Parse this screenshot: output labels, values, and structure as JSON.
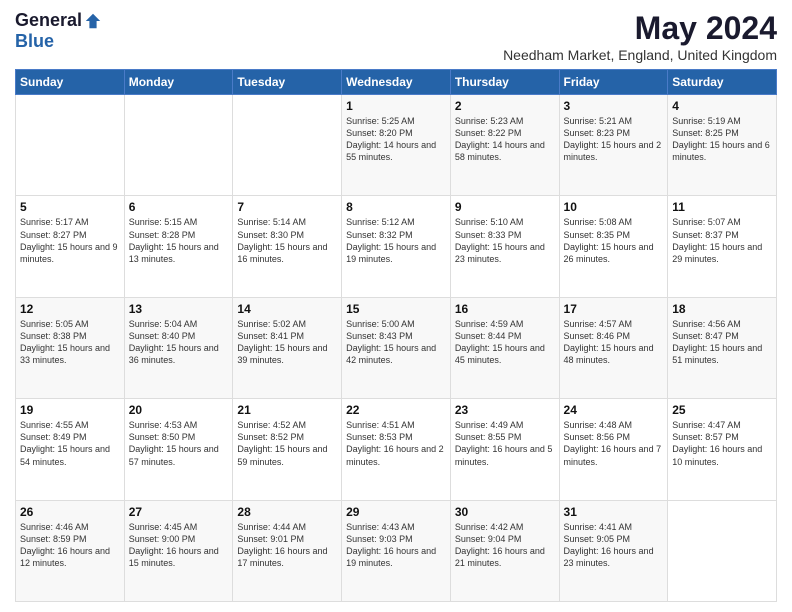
{
  "header": {
    "logo_general": "General",
    "logo_blue": "Blue",
    "month_title": "May 2024",
    "location": "Needham Market, England, United Kingdom"
  },
  "days_of_week": [
    "Sunday",
    "Monday",
    "Tuesday",
    "Wednesday",
    "Thursday",
    "Friday",
    "Saturday"
  ],
  "weeks": [
    [
      {
        "day": "",
        "sunrise": "",
        "sunset": "",
        "daylight": ""
      },
      {
        "day": "",
        "sunrise": "",
        "sunset": "",
        "daylight": ""
      },
      {
        "day": "",
        "sunrise": "",
        "sunset": "",
        "daylight": ""
      },
      {
        "day": "1",
        "sunrise": "Sunrise: 5:25 AM",
        "sunset": "Sunset: 8:20 PM",
        "daylight": "Daylight: 14 hours and 55 minutes."
      },
      {
        "day": "2",
        "sunrise": "Sunrise: 5:23 AM",
        "sunset": "Sunset: 8:22 PM",
        "daylight": "Daylight: 14 hours and 58 minutes."
      },
      {
        "day": "3",
        "sunrise": "Sunrise: 5:21 AM",
        "sunset": "Sunset: 8:23 PM",
        "daylight": "Daylight: 15 hours and 2 minutes."
      },
      {
        "day": "4",
        "sunrise": "Sunrise: 5:19 AM",
        "sunset": "Sunset: 8:25 PM",
        "daylight": "Daylight: 15 hours and 6 minutes."
      }
    ],
    [
      {
        "day": "5",
        "sunrise": "Sunrise: 5:17 AM",
        "sunset": "Sunset: 8:27 PM",
        "daylight": "Daylight: 15 hours and 9 minutes."
      },
      {
        "day": "6",
        "sunrise": "Sunrise: 5:15 AM",
        "sunset": "Sunset: 8:28 PM",
        "daylight": "Daylight: 15 hours and 13 minutes."
      },
      {
        "day": "7",
        "sunrise": "Sunrise: 5:14 AM",
        "sunset": "Sunset: 8:30 PM",
        "daylight": "Daylight: 15 hours and 16 minutes."
      },
      {
        "day": "8",
        "sunrise": "Sunrise: 5:12 AM",
        "sunset": "Sunset: 8:32 PM",
        "daylight": "Daylight: 15 hours and 19 minutes."
      },
      {
        "day": "9",
        "sunrise": "Sunrise: 5:10 AM",
        "sunset": "Sunset: 8:33 PM",
        "daylight": "Daylight: 15 hours and 23 minutes."
      },
      {
        "day": "10",
        "sunrise": "Sunrise: 5:08 AM",
        "sunset": "Sunset: 8:35 PM",
        "daylight": "Daylight: 15 hours and 26 minutes."
      },
      {
        "day": "11",
        "sunrise": "Sunrise: 5:07 AM",
        "sunset": "Sunset: 8:37 PM",
        "daylight": "Daylight: 15 hours and 29 minutes."
      }
    ],
    [
      {
        "day": "12",
        "sunrise": "Sunrise: 5:05 AM",
        "sunset": "Sunset: 8:38 PM",
        "daylight": "Daylight: 15 hours and 33 minutes."
      },
      {
        "day": "13",
        "sunrise": "Sunrise: 5:04 AM",
        "sunset": "Sunset: 8:40 PM",
        "daylight": "Daylight: 15 hours and 36 minutes."
      },
      {
        "day": "14",
        "sunrise": "Sunrise: 5:02 AM",
        "sunset": "Sunset: 8:41 PM",
        "daylight": "Daylight: 15 hours and 39 minutes."
      },
      {
        "day": "15",
        "sunrise": "Sunrise: 5:00 AM",
        "sunset": "Sunset: 8:43 PM",
        "daylight": "Daylight: 15 hours and 42 minutes."
      },
      {
        "day": "16",
        "sunrise": "Sunrise: 4:59 AM",
        "sunset": "Sunset: 8:44 PM",
        "daylight": "Daylight: 15 hours and 45 minutes."
      },
      {
        "day": "17",
        "sunrise": "Sunrise: 4:57 AM",
        "sunset": "Sunset: 8:46 PM",
        "daylight": "Daylight: 15 hours and 48 minutes."
      },
      {
        "day": "18",
        "sunrise": "Sunrise: 4:56 AM",
        "sunset": "Sunset: 8:47 PM",
        "daylight": "Daylight: 15 hours and 51 minutes."
      }
    ],
    [
      {
        "day": "19",
        "sunrise": "Sunrise: 4:55 AM",
        "sunset": "Sunset: 8:49 PM",
        "daylight": "Daylight: 15 hours and 54 minutes."
      },
      {
        "day": "20",
        "sunrise": "Sunrise: 4:53 AM",
        "sunset": "Sunset: 8:50 PM",
        "daylight": "Daylight: 15 hours and 57 minutes."
      },
      {
        "day": "21",
        "sunrise": "Sunrise: 4:52 AM",
        "sunset": "Sunset: 8:52 PM",
        "daylight": "Daylight: 15 hours and 59 minutes."
      },
      {
        "day": "22",
        "sunrise": "Sunrise: 4:51 AM",
        "sunset": "Sunset: 8:53 PM",
        "daylight": "Daylight: 16 hours and 2 minutes."
      },
      {
        "day": "23",
        "sunrise": "Sunrise: 4:49 AM",
        "sunset": "Sunset: 8:55 PM",
        "daylight": "Daylight: 16 hours and 5 minutes."
      },
      {
        "day": "24",
        "sunrise": "Sunrise: 4:48 AM",
        "sunset": "Sunset: 8:56 PM",
        "daylight": "Daylight: 16 hours and 7 minutes."
      },
      {
        "day": "25",
        "sunrise": "Sunrise: 4:47 AM",
        "sunset": "Sunset: 8:57 PM",
        "daylight": "Daylight: 16 hours and 10 minutes."
      }
    ],
    [
      {
        "day": "26",
        "sunrise": "Sunrise: 4:46 AM",
        "sunset": "Sunset: 8:59 PM",
        "daylight": "Daylight: 16 hours and 12 minutes."
      },
      {
        "day": "27",
        "sunrise": "Sunrise: 4:45 AM",
        "sunset": "Sunset: 9:00 PM",
        "daylight": "Daylight: 16 hours and 15 minutes."
      },
      {
        "day": "28",
        "sunrise": "Sunrise: 4:44 AM",
        "sunset": "Sunset: 9:01 PM",
        "daylight": "Daylight: 16 hours and 17 minutes."
      },
      {
        "day": "29",
        "sunrise": "Sunrise: 4:43 AM",
        "sunset": "Sunset: 9:03 PM",
        "daylight": "Daylight: 16 hours and 19 minutes."
      },
      {
        "day": "30",
        "sunrise": "Sunrise: 4:42 AM",
        "sunset": "Sunset: 9:04 PM",
        "daylight": "Daylight: 16 hours and 21 minutes."
      },
      {
        "day": "31",
        "sunrise": "Sunrise: 4:41 AM",
        "sunset": "Sunset: 9:05 PM",
        "daylight": "Daylight: 16 hours and 23 minutes."
      },
      {
        "day": "",
        "sunrise": "",
        "sunset": "",
        "daylight": ""
      }
    ]
  ]
}
